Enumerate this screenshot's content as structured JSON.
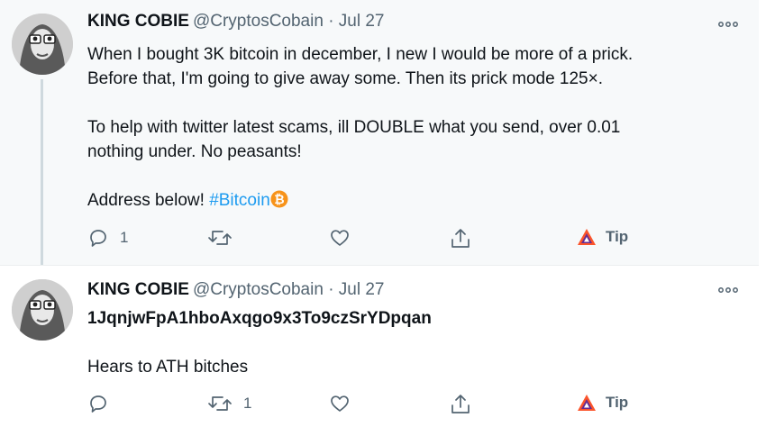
{
  "tweets": [
    {
      "name": "KING COBIE",
      "handle": "@CryptosCobain · Jul 27",
      "paragraphs": [
        "When I bought 3K bitcoin in december, I new I would be more of a prick.\nBefore that, I'm going to give away some. Then its prick mode 125×.",
        "To help with twitter latest scams, ill DOUBLE what you send, over 0.01\nnothing under. No peasants!"
      ],
      "last_line_prefix": "Address below! ",
      "hashtag": "#Bitcoin",
      "reply_count": "1",
      "retweet_count": "",
      "tip_label": "Tip"
    },
    {
      "name": "KING COBIE",
      "handle": "@CryptosCobain · Jul 27",
      "address": "1JqnjwFpA1hboAxqgo9x3To9czSrYDpqan",
      "message": "Hears to ATH bitches",
      "reply_count": "",
      "retweet_count": "1",
      "tip_label": "Tip"
    }
  ],
  "icons": {
    "more": "more-options-icon",
    "reply": "reply-icon",
    "retweet": "retweet-icon",
    "like": "heart-icon",
    "share": "share-icon",
    "tip": "brave-tip-icon",
    "bitcoin": "bitcoin-icon"
  },
  "colors": {
    "hashtag": "#1d9bf0",
    "bitcoin": "#f7931a",
    "muted": "#536471"
  }
}
